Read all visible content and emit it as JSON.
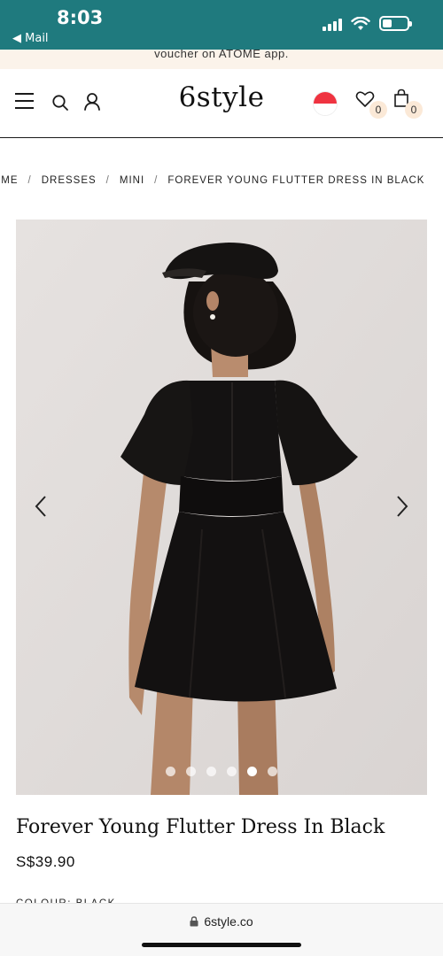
{
  "status_bar": {
    "time": "8:03",
    "back_label": "◀ Mail"
  },
  "announcement": {
    "text": "voucher on ATOME app."
  },
  "header": {
    "logo": "6style",
    "wishlist_count": "0",
    "cart_count": "0"
  },
  "breadcrumb": {
    "items": [
      "HOME",
      "DRESSES",
      "MINI",
      "FOREVER YOUNG FLUTTER DRESS IN BLACK"
    ],
    "separator": "/"
  },
  "gallery": {
    "slide_count": 6,
    "active_index": 4,
    "prev_icon": "chevron-left-icon",
    "next_icon": "chevron-right-icon"
  },
  "product": {
    "title": "Forever Young Flutter Dress In Black",
    "price": "S$39.90",
    "colour_label": "COLOUR: BLACK"
  },
  "browser": {
    "url": "6style.co"
  },
  "colors": {
    "status_bar": "#1f7a7e",
    "announcement_bg": "#fbf3ea",
    "badge_bg": "#fbe9d7",
    "gallery_bg": "#e3dfdd"
  }
}
